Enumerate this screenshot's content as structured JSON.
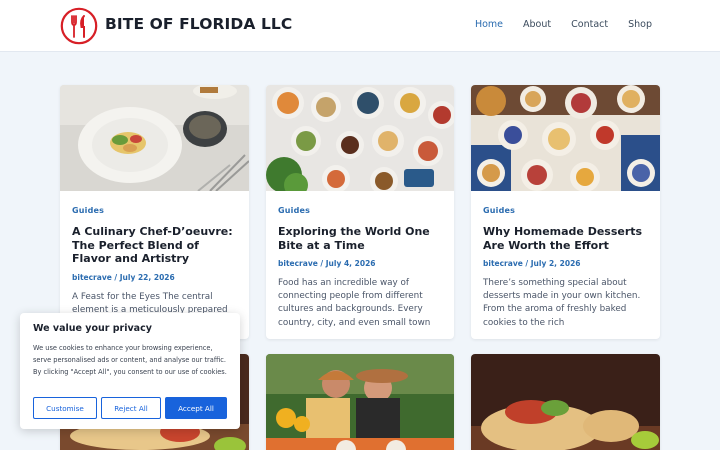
{
  "site": {
    "title": "BITE OF FLORIDA LLC",
    "brand_color": "#d71f26",
    "accent_color": "#2b6cb0"
  },
  "nav": {
    "items": [
      {
        "label": "Home",
        "active": true
      },
      {
        "label": "About",
        "active": false
      },
      {
        "label": "Contact",
        "active": false
      },
      {
        "label": "Shop",
        "active": false
      }
    ]
  },
  "posts": [
    {
      "category": "Guides",
      "title": "A Culinary Chef-D’oeuvre: The Perfect Blend of Flavor and Artistry",
      "author": "bitecrave",
      "date": "July 22, 2026",
      "excerpt": "A Feast for the Eyes The central element is a meticulously prepared dish served",
      "image": "plated-gourmet-dish"
    },
    {
      "category": "Guides",
      "title": "Exploring the World One Bite at a Time",
      "author": "bitecrave",
      "date": "July 4, 2026",
      "excerpt": "Food has an incredible way of connecting people from different cultures and backgrounds. Every country, city, and even small town",
      "image": "table-spread-overhead"
    },
    {
      "category": "Guides",
      "title": "Why Homemade Desserts Are Worth the Effort",
      "author": "bitecrave",
      "date": "July 2, 2026",
      "excerpt": "There’s something special about desserts made in your own kitchen. From the aroma of freshly baked cookies to the rich",
      "image": "dessert-table-overhead"
    },
    {
      "image": "burrito-wrap"
    },
    {
      "image": "friends-dining-outdoors"
    },
    {
      "image": "burrito-wrap-close"
    }
  ],
  "cookie": {
    "title": "We value your privacy",
    "text": "We use cookies to enhance your browsing experience, serve personalised ads or content, and analyse our traffic. By clicking \"Accept All\", you consent to our use of cookies.",
    "customise": "Customise",
    "reject": "Reject All",
    "accept": "Accept All",
    "button_color": "#1863dc"
  }
}
